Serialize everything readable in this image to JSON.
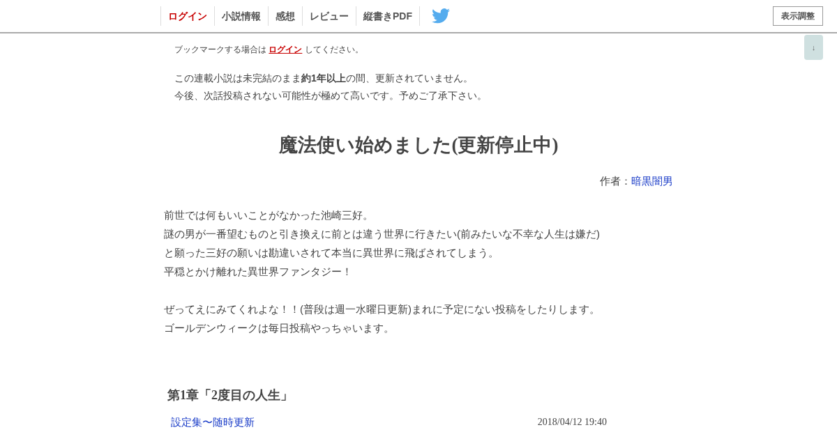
{
  "nav": {
    "items": [
      {
        "label": "ログイン",
        "selected": true
      },
      {
        "label": "小説情報",
        "selected": false
      },
      {
        "label": "感想",
        "selected": false
      },
      {
        "label": "レビュー",
        "selected": false
      },
      {
        "label": "縦書きPDF",
        "selected": false
      }
    ],
    "display_button": "表示調整",
    "scroll_button": "↓"
  },
  "bookmark_notice": {
    "before": "ブックマークする場合は ",
    "link": "ログイン",
    "after": " してください。"
  },
  "warning": [
    "この連載小説は未完結のまま**約1年以上**の間、更新されていません。",
    "今後、次話投稿されない可能性が極めて高いです。予めご了承下さい。"
  ],
  "title": "魔法使い始めました(更新停止中)",
  "author": {
    "label": "作者：",
    "name": "暗黒闇男"
  },
  "synopsis": [
    [
      "前世では何もいいことがなかった池崎三好。",
      "謎の男が一番望むものと引き換えに前とは違う世界に行きたい(前みたいな不幸な人生は嫌だ)",
      "と願った三好の願いは勘違いされて本当に異世界に飛ばされてしまう。",
      "平穏とかけ離れた異世界ファンタジー！"
    ],
    [
      "ぜってえにみてくれよな！！(普段は週一水曜日更新)まれに予定にない投稿をしたりします。",
      "ゴールデンウィークは毎日投稿やっちゃいます。"
    ]
  ],
  "chapters": [
    {
      "title": "第1章「2度目の人生」",
      "episodes": [
        {
          "title": "設定集〜随時更新",
          "date": "2018/04/12 19:40"
        }
      ]
    }
  ]
}
